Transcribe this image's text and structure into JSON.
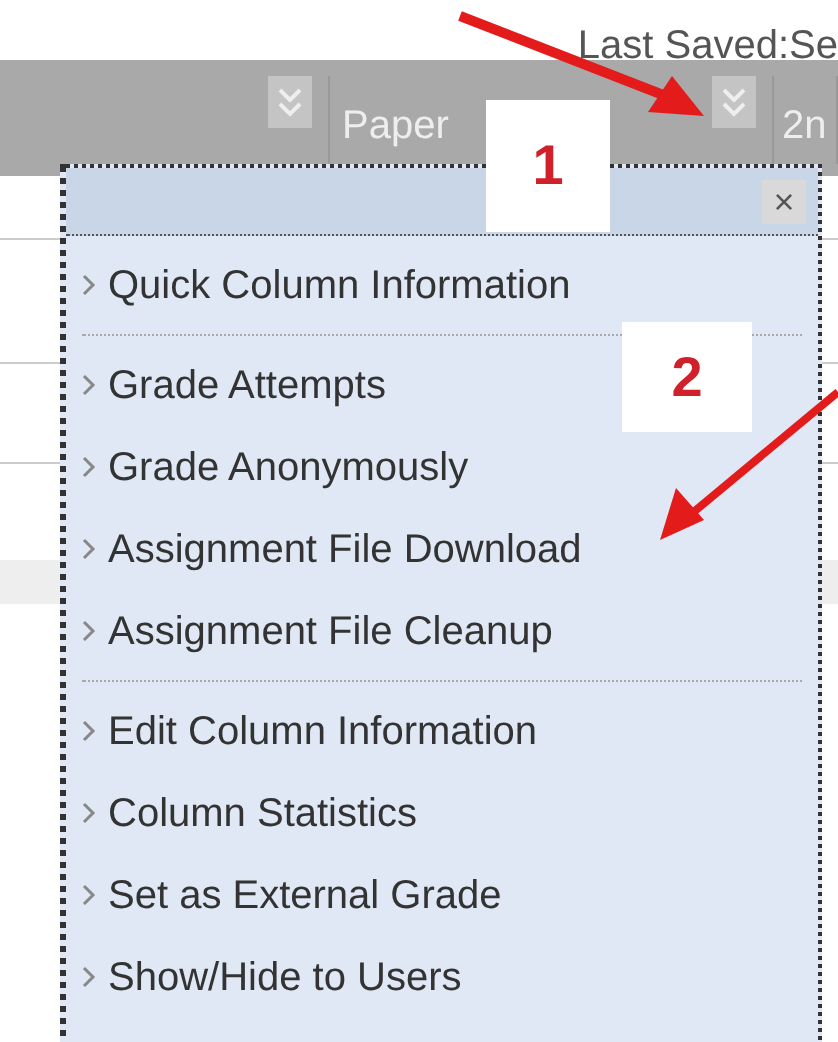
{
  "status": {
    "last_saved": "Last Saved:Se"
  },
  "columns": [
    {},
    {
      "label": "Paper"
    },
    {
      "label": "2n"
    }
  ],
  "menu": {
    "close": "×",
    "groups": [
      {
        "items": [
          {
            "label": "Quick Column Information"
          }
        ]
      },
      {
        "items": [
          {
            "label": "Grade Attempts"
          },
          {
            "label": "Grade Anonymously"
          },
          {
            "label": "Assignment File Download"
          },
          {
            "label": "Assignment File Cleanup"
          }
        ]
      },
      {
        "items": [
          {
            "label": "Edit Column Information"
          },
          {
            "label": "Column Statistics"
          },
          {
            "label": "Set as External Grade"
          },
          {
            "label": "Show/Hide to Users"
          }
        ]
      }
    ]
  },
  "callouts": [
    {
      "label": "1"
    },
    {
      "label": "2"
    }
  ]
}
